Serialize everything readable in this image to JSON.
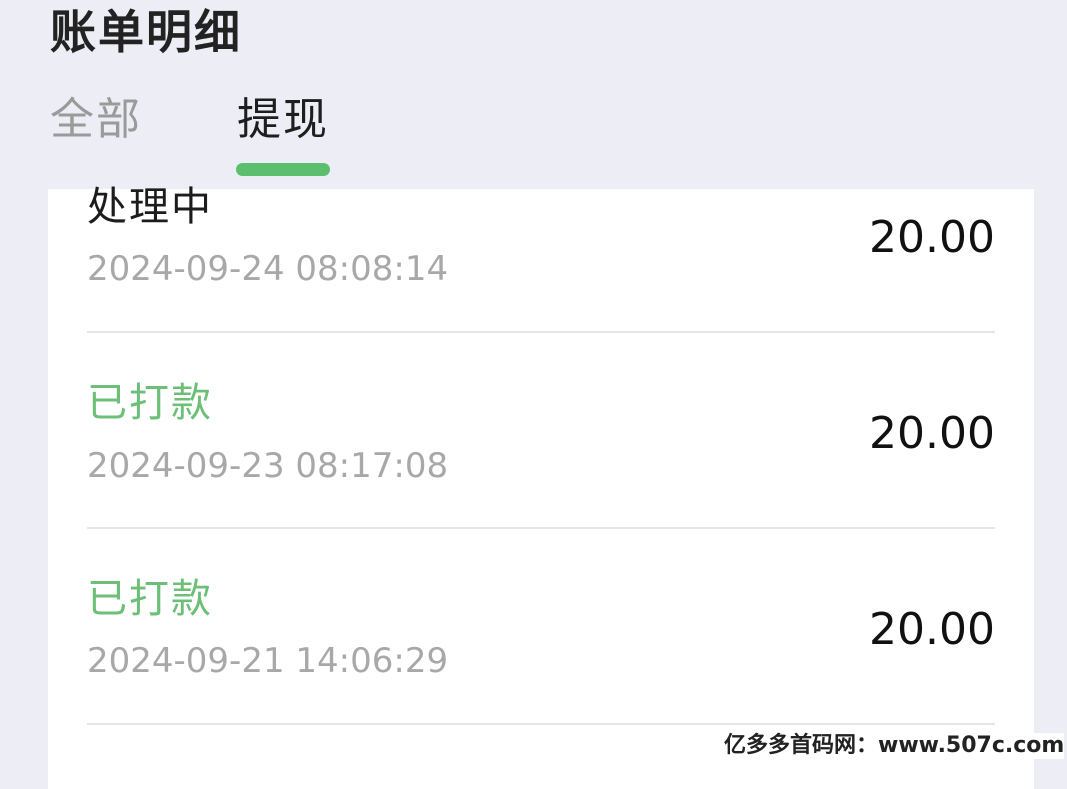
{
  "header": {
    "title": "账单明细"
  },
  "tabs": [
    {
      "label": "全部",
      "active": false
    },
    {
      "label": "提现",
      "active": true
    }
  ],
  "accent_color": "#5cbf6e",
  "records": [
    {
      "status": "处理中",
      "time": "2024-09-24 08:08:14",
      "amount": "20.00",
      "status_color": "#1c1c1c"
    },
    {
      "status": "已打款",
      "time": "2024-09-23 08:17:08",
      "amount": "20.00",
      "status_color": "#6dbf78"
    },
    {
      "status": "已打款",
      "time": "2024-09-21 14:06:29",
      "amount": "20.00",
      "status_color": "#6dbf78"
    }
  ],
  "watermark": "亿多多首码网：www.507c.com"
}
